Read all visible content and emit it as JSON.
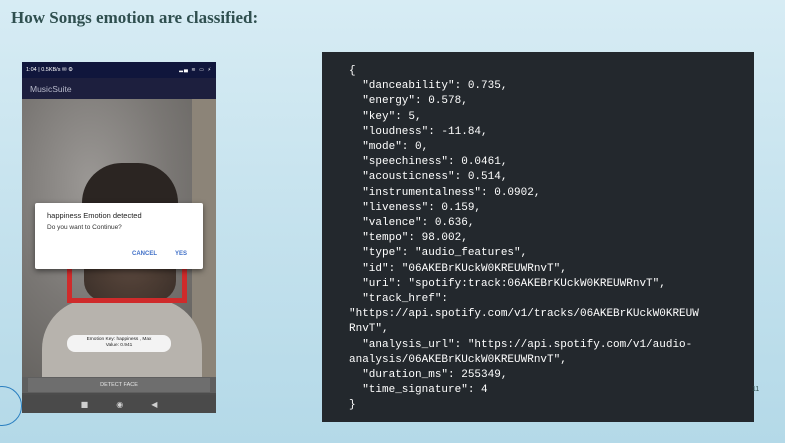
{
  "slide": {
    "title": "How Songs emotion are classified:",
    "page_number": "11"
  },
  "phone": {
    "status_bar": {
      "time_net": "1:04 | 0.5KB/s",
      "left_icons": "✉ ⚙",
      "right_icons": "▂▄ ≋ ▭ ⚡"
    },
    "app_title": "MusicSuite",
    "dialog": {
      "title": "happiness Emotion detected",
      "message": "Do you want to Continue?",
      "cancel_label": "CANCEL",
      "yes_label": "YES"
    },
    "emotion_chip": {
      "line1": "Emotion Key: happiness , Max",
      "line2": "Value: 0.941"
    },
    "detect_button_label": "DETECT FACE",
    "nav": {
      "recents": "■",
      "home": "◉",
      "back": "◀"
    }
  },
  "code": {
    "lines": [
      "{",
      "  \"danceability\": 0.735,",
      "  \"energy\": 0.578,",
      "  \"key\": 5,",
      "  \"loudness\": -11.84,",
      "  \"mode\": 0,",
      "  \"speechiness\": 0.0461,",
      "  \"acousticness\": 0.514,",
      "  \"instrumentalness\": 0.0902,",
      "  \"liveness\": 0.159,",
      "  \"valence\": 0.636,",
      "  \"tempo\": 98.002,",
      "  \"type\": \"audio_features\",",
      "  \"id\": \"06AKEBrKUckW0KREUWRnvT\",",
      "  \"uri\": \"spotify:track:06AKEBrKUckW0KREUWRnvT\",",
      "  \"track_href\":",
      "\"https://api.spotify.com/v1/tracks/06AKEBrKUckW0KREUW",
      "RnvT\",",
      "  \"analysis_url\": \"https://api.spotify.com/v1/audio-",
      "analysis/06AKEBrKUckW0KREUWRnvT\",",
      "  \"duration_ms\": 255349,",
      "  \"time_signature\": 4",
      "}"
    ]
  },
  "colors": {
    "code_background": "#23282d",
    "face_box": "#cf2b2b",
    "dialog_button": "#3f6fc7",
    "app_bar": "#1d1f3e"
  }
}
